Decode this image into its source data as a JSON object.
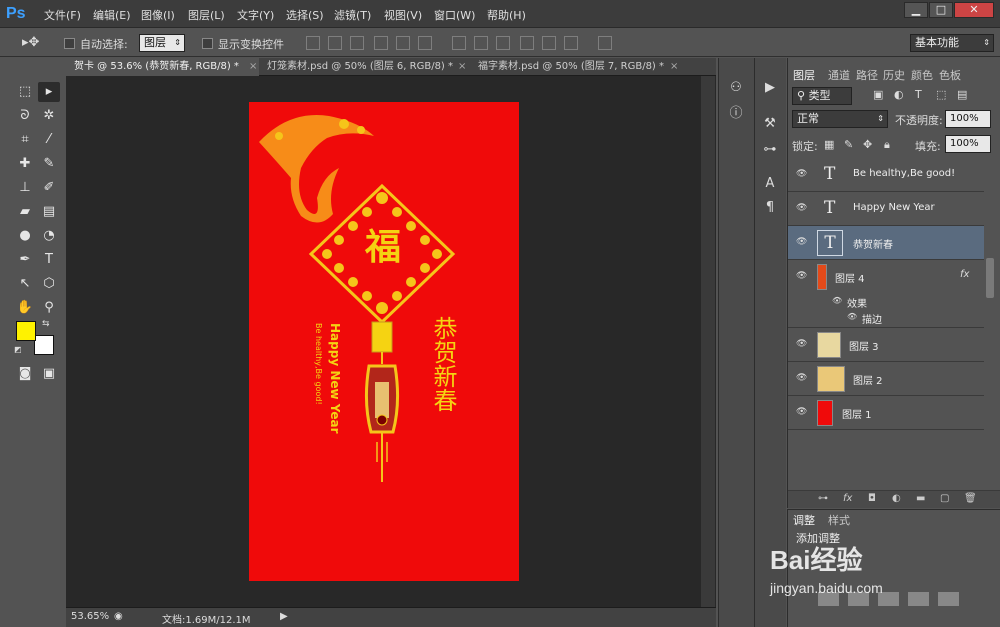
{
  "app": {
    "logo": "Ps"
  },
  "menu": [
    "文件(F)",
    "编辑(E)",
    "图像(I)",
    "图层(L)",
    "文字(Y)",
    "选择(S)",
    "滤镜(T)",
    "视图(V)",
    "窗口(W)",
    "帮助(H)"
  ],
  "window_buttons": [
    "▁",
    "□",
    "✕"
  ],
  "options": {
    "auto_select_label": "自动选择:",
    "auto_select_value": "图层",
    "show_transform_label": "显示变换控件",
    "workspace": "基本功能"
  },
  "tabs": [
    {
      "label": "贺卡 @ 53.6% (恭贺新春, RGB/8) *",
      "close": "×"
    },
    {
      "label": "灯笼素材.psd @ 50% (图层 6, RGB/8) *",
      "close": "×"
    },
    {
      "label": "福字素材.psd @ 50% (图层 7, RGB/8) *",
      "close": "×"
    }
  ],
  "canvas": {
    "fu": "福",
    "greeting_cn": "恭贺新春",
    "greeting_en": "Happy New Year",
    "greeting_en2": "Be healthy,Be good!",
    "bg_color": "#f00a0a",
    "gold": "#f5c51a"
  },
  "status": {
    "zoom": "53.65%",
    "doc": "文档:1.69M/12.1M"
  },
  "layers_panel": {
    "tabs": [
      "图层",
      "通道",
      "路径",
      "历史",
      "颜色",
      "色板"
    ],
    "filter": "类型",
    "blend_mode": "正常",
    "opacity_label": "不透明度:",
    "opacity": "100%",
    "lock_label": "锁定:",
    "fill_label": "填充:",
    "fill": "100%",
    "layers": [
      {
        "name": "Be healthy,Be good!",
        "type": "text"
      },
      {
        "name": "Happy New Year",
        "type": "text"
      },
      {
        "name": "恭贺新春",
        "type": "text",
        "selected": true
      },
      {
        "name": "图层 4",
        "type": "image",
        "fx": "fx"
      },
      {
        "name": "效果",
        "type": "effect"
      },
      {
        "name": "描边",
        "type": "effect"
      },
      {
        "name": "图层 3",
        "type": "image"
      },
      {
        "name": "图层 2",
        "type": "image"
      },
      {
        "name": "图层 1",
        "type": "fill"
      }
    ]
  },
  "adjust_panel": {
    "tabs": [
      "调整",
      "样式"
    ],
    "title": "添加调整"
  },
  "watermark": {
    "brand": "Bai经验",
    "url": "jingyan.baidu.com"
  }
}
